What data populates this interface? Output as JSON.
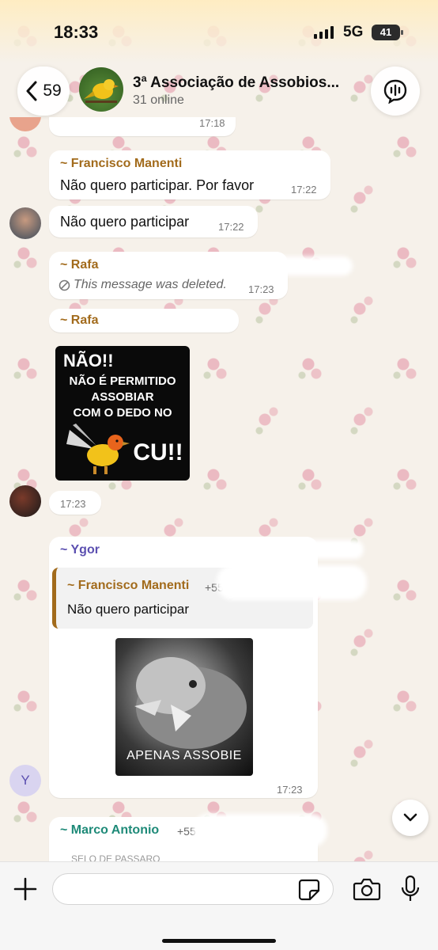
{
  "status": {
    "time": "18:33",
    "network": "5G",
    "battery": "41"
  },
  "header": {
    "back_count": "59",
    "title": "3ª Associação de Assobios...",
    "subtitle": "31 online"
  },
  "messages": {
    "m0": {
      "time": "17:18"
    },
    "m1": {
      "sender": "~ Francisco Manenti",
      "text": "Não quero participar. Por favor",
      "time": "17:22"
    },
    "m2": {
      "text": "Não quero participar",
      "time": "17:22"
    },
    "m3": {
      "sender": "~ Rafa",
      "text": "This message was deleted.",
      "time": "17:23"
    },
    "m4": {
      "sender": "~ Rafa",
      "sticker_lines": [
        "NÃO!!",
        "NÃO É PERMITIDO",
        "ASSOBIAR",
        "COM O DEDO NO",
        "CU!!"
      ]
    },
    "m5": {
      "time": "17:23"
    },
    "m6": {
      "sender": "~ Ygor",
      "reply_sender": "~ Francisco Manenti",
      "reply_phone_fragment": "+55",
      "reply_text": "Não quero participar",
      "sticker_caption": "APENAS ASSOBIE",
      "time": "17:23",
      "avatar_letter": "Y"
    },
    "m7": {
      "sender": "~ Marco Antonio",
      "phone_fragment": "+55 21 965",
      "preview_fragment": "SELO DE PASSARO"
    }
  },
  "colors": {
    "sender_brown": "#a26b1c",
    "sender_purple": "#5b4fb0",
    "sender_green": "#1e8a78",
    "bubble": "#ffffff"
  },
  "icons": [
    "chevron-left-icon",
    "audio-wave-icon",
    "chevron-down-icon",
    "plus-icon",
    "sticker-icon",
    "camera-icon",
    "microphone-icon",
    "deleted-icon"
  ]
}
